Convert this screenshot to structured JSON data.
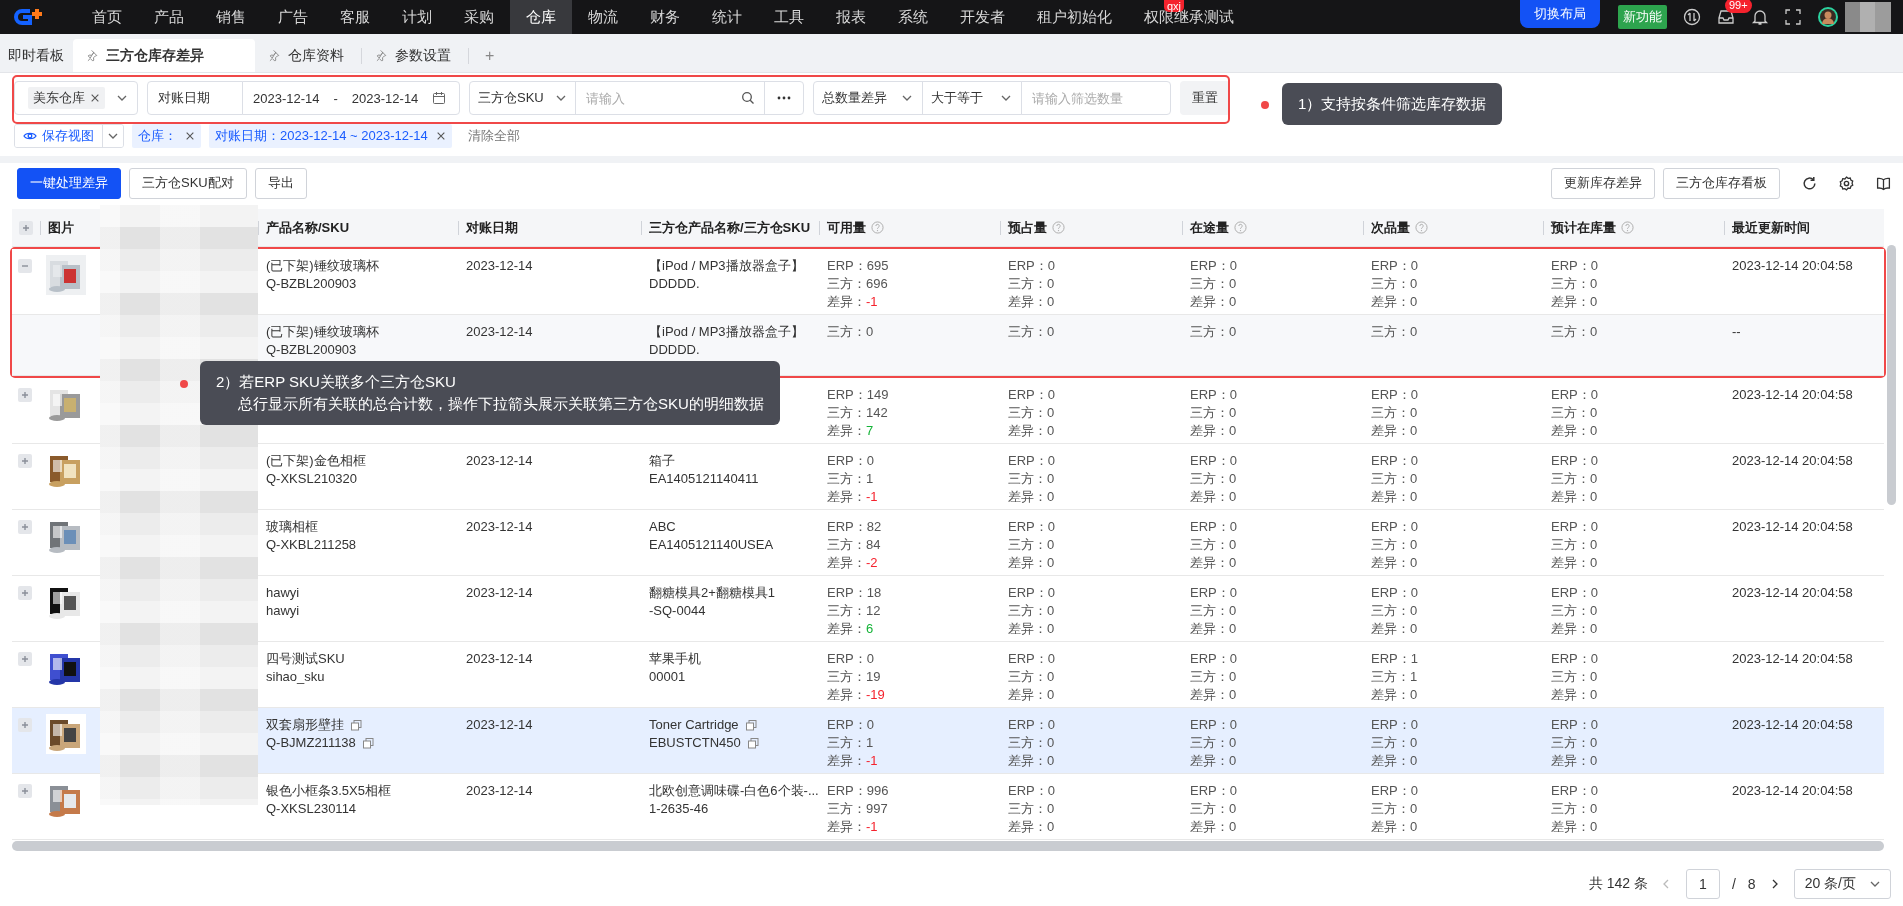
{
  "top_nav": {
    "items": [
      {
        "label": "首页",
        "selected": false
      },
      {
        "label": "产品",
        "selected": false
      },
      {
        "label": "销售",
        "selected": false
      },
      {
        "label": "广告",
        "selected": false
      },
      {
        "label": "客服",
        "selected": false
      },
      {
        "label": "计划",
        "selected": false
      },
      {
        "label": "采购",
        "selected": false
      },
      {
        "label": "仓库",
        "selected": true
      },
      {
        "label": "物流",
        "selected": false
      },
      {
        "label": "财务",
        "selected": false
      },
      {
        "label": "统计",
        "selected": false
      },
      {
        "label": "工具",
        "selected": false
      },
      {
        "label": "报表",
        "selected": false
      },
      {
        "label": "系统",
        "selected": false
      },
      {
        "label": "开发者",
        "selected": false
      },
      {
        "label": "租户初始化",
        "selected": false
      },
      {
        "label": "权限继承测试",
        "selected": false,
        "tag": "qxj"
      }
    ],
    "layout_button": "切换布局",
    "new_badge": "新功能",
    "inbox_count": "99+"
  },
  "tab_bar": {
    "tabs": [
      {
        "label": "即时看板",
        "selected": false,
        "pinned": false
      },
      {
        "label": "三方仓库存差异",
        "selected": true,
        "pinned": true
      },
      {
        "label": "仓库资料",
        "selected": false,
        "pinned": true
      },
      {
        "label": "参数设置",
        "selected": false,
        "pinned": true
      }
    ],
    "add": "+"
  },
  "filters": {
    "warehouse_tag": "美东仓库",
    "date_label": "对账日期",
    "date_start": "2023-12-14",
    "date_separator": "-",
    "date_end": "2023-12-14",
    "sku_type": "三方仓SKU",
    "search_placeholder": "请输入",
    "diff_type": "总数量差异",
    "comparator": "大于等于",
    "quantity_placeholder": "请输入筛选数量",
    "reset": "重置"
  },
  "chips": {
    "save_view": "保存视图",
    "tags": [
      "仓库：",
      "对账日期：2023-12-14 ~ 2023-12-14"
    ],
    "clear": "清除全部"
  },
  "actions": {
    "left": [
      {
        "label": "一键处理差异",
        "kind": "primary"
      },
      {
        "label": "三方仓SKU配对",
        "kind": "default"
      },
      {
        "label": "导出",
        "kind": "default"
      }
    ],
    "right": [
      {
        "label": "更新库存差异",
        "kind": "default"
      },
      {
        "label": "三方仓库存看板",
        "kind": "default"
      }
    ]
  },
  "table": {
    "columns": [
      {
        "label": "图片",
        "help": false
      },
      {
        "label": "产品名称/SKU",
        "help": false
      },
      {
        "label": "对账日期",
        "help": false
      },
      {
        "label": "三方仓产品名称/三方仓SKU",
        "help": false
      },
      {
        "label": "可用量",
        "help": true
      },
      {
        "label": "预占量",
        "help": true
      },
      {
        "label": "在途量",
        "help": true
      },
      {
        "label": "次品量",
        "help": true
      },
      {
        "label": "预计在库量",
        "help": true
      },
      {
        "label": "最近更新时间",
        "help": false
      }
    ],
    "rows": [
      {
        "kind": "main",
        "expanded": true,
        "selected": false,
        "image": {
          "kind": "picture"
        },
        "product_name": "(已下架)锤纹玻璃杯",
        "sku": "Q-BZBL200903",
        "copyable": false,
        "date": "2023-12-14",
        "tp_name": "【iPod / MP3播放器盒子】",
        "tp_sku": "DDDDD.",
        "metrics": [
          [
            {
              "label": "ERP：",
              "value": "695"
            },
            {
              "label": "三方：",
              "value": "696"
            },
            {
              "label": "差异：",
              "value": "-1",
              "color": "#f5222d"
            }
          ],
          [
            {
              "label": "ERP：",
              "value": "0"
            },
            {
              "label": "三方：",
              "value": "0"
            },
            {
              "label": "差异：",
              "value": "0"
            }
          ],
          [
            {
              "label": "ERP：",
              "value": "0"
            },
            {
              "label": "三方：",
              "value": "0"
            },
            {
              "label": "差异：",
              "value": "0"
            }
          ],
          [
            {
              "label": "ERP：",
              "value": "0"
            },
            {
              "label": "三方：",
              "value": "0"
            },
            {
              "label": "差异：",
              "value": "0"
            }
          ],
          [
            {
              "label": "ERP：",
              "value": "0"
            },
            {
              "label": "三方：",
              "value": "0"
            },
            {
              "label": "差异：",
              "value": "0"
            }
          ]
        ],
        "updated": "2023-12-14 20:04:58"
      },
      {
        "kind": "detail",
        "selected": false,
        "product_name": "(已下架)锤纹玻璃杯",
        "sku": "Q-BZBL200903",
        "copyable": false,
        "date": "2023-12-14",
        "tp_name": "【iPod / MP3播放器盒子】",
        "tp_sku": "DDDDD.",
        "metrics": [
          [
            {
              "label": "三方：",
              "value": "0"
            }
          ],
          [
            {
              "label": "三方：",
              "value": "0"
            }
          ],
          [
            {
              "label": "三方：",
              "value": "0"
            }
          ],
          [
            {
              "label": "三方：",
              "value": "0"
            }
          ],
          [
            {
              "label": "三方：",
              "value": "0"
            }
          ]
        ],
        "updated": "--"
      },
      {
        "kind": "main",
        "expanded": false,
        "selected": false,
        "image": {
          "kind": "picture"
        },
        "metrics": [
          [
            {
              "label": "ERP：",
              "value": "149"
            },
            {
              "label": "三方：",
              "value": "142"
            },
            {
              "label": "差异：",
              "value": "7",
              "color": "#14b337"
            }
          ],
          [
            {
              "label": "ERP：",
              "value": "0"
            },
            {
              "label": "三方：",
              "value": "0"
            },
            {
              "label": "差异：",
              "value": "0"
            }
          ],
          [
            {
              "label": "ERP：",
              "value": "0"
            },
            {
              "label": "三方：",
              "value": "0"
            },
            {
              "label": "差异：",
              "value": "0"
            }
          ],
          [
            {
              "label": "ERP：",
              "value": "0"
            },
            {
              "label": "三方：",
              "value": "0"
            },
            {
              "label": "差异：",
              "value": "0"
            }
          ],
          [
            {
              "label": "ERP：",
              "value": "0"
            },
            {
              "label": "三方：",
              "value": "0"
            },
            {
              "label": "差异：",
              "value": "0"
            }
          ]
        ],
        "updated": "2023-12-14 20:04:58"
      },
      {
        "kind": "main",
        "expanded": false,
        "selected": false,
        "image": {
          "kind": "picture"
        },
        "product_name": "(已下架)金色相框",
        "sku": "Q-XKSL210320",
        "copyable": false,
        "date": "2023-12-14",
        "tp_name": "箱子",
        "tp_sku": "EA1405121140411",
        "metrics": [
          [
            {
              "label": "ERP：",
              "value": "0"
            },
            {
              "label": "三方：",
              "value": "1"
            },
            {
              "label": "差异：",
              "value": "-1",
              "color": "#f5222d"
            }
          ],
          [
            {
              "label": "ERP：",
              "value": "0"
            },
            {
              "label": "三方：",
              "value": "0"
            },
            {
              "label": "差异：",
              "value": "0"
            }
          ],
          [
            {
              "label": "ERP：",
              "value": "0"
            },
            {
              "label": "三方：",
              "value": "0"
            },
            {
              "label": "差异：",
              "value": "0"
            }
          ],
          [
            {
              "label": "ERP：",
              "value": "0"
            },
            {
              "label": "三方：",
              "value": "0"
            },
            {
              "label": "差异：",
              "value": "0"
            }
          ],
          [
            {
              "label": "ERP：",
              "value": "0"
            },
            {
              "label": "三方：",
              "value": "0"
            },
            {
              "label": "差异：",
              "value": "0"
            }
          ]
        ],
        "updated": "2023-12-14 20:04:58"
      },
      {
        "kind": "main",
        "expanded": false,
        "selected": false,
        "image": {
          "kind": "picture"
        },
        "product_name": "玻璃相框",
        "sku": "Q-XKBL211258",
        "copyable": false,
        "date": "2023-12-14",
        "tp_name": "ABC",
        "tp_sku": "EA1405121140USEA",
        "metrics": [
          [
            {
              "label": "ERP：",
              "value": "82"
            },
            {
              "label": "三方：",
              "value": "84"
            },
            {
              "label": "差异：",
              "value": "-2",
              "color": "#f5222d"
            }
          ],
          [
            {
              "label": "ERP：",
              "value": "0"
            },
            {
              "label": "三方：",
              "value": "0"
            },
            {
              "label": "差异：",
              "value": "0"
            }
          ],
          [
            {
              "label": "ERP：",
              "value": "0"
            },
            {
              "label": "三方：",
              "value": "0"
            },
            {
              "label": "差异：",
              "value": "0"
            }
          ],
          [
            {
              "label": "ERP：",
              "value": "0"
            },
            {
              "label": "三方：",
              "value": "0"
            },
            {
              "label": "差异：",
              "value": "0"
            }
          ],
          [
            {
              "label": "ERP：",
              "value": "0"
            },
            {
              "label": "三方：",
              "value": "0"
            },
            {
              "label": "差异：",
              "value": "0"
            }
          ]
        ],
        "updated": "2023-12-14 20:04:58"
      },
      {
        "kind": "main",
        "expanded": false,
        "selected": false,
        "image": {
          "kind": "picture"
        },
        "product_name": "hawyi",
        "sku": "hawyi",
        "copyable": false,
        "date": "2023-12-14",
        "tp_name": "翻糖模具2+翻糖模具1",
        "tp_sku": "-SQ-0044",
        "metrics": [
          [
            {
              "label": "ERP：",
              "value": "18"
            },
            {
              "label": "三方：",
              "value": "12"
            },
            {
              "label": "差异：",
              "value": "6",
              "color": "#14b337"
            }
          ],
          [
            {
              "label": "ERP：",
              "value": "0"
            },
            {
              "label": "三方：",
              "value": "0"
            },
            {
              "label": "差异：",
              "value": "0"
            }
          ],
          [
            {
              "label": "ERP：",
              "value": "0"
            },
            {
              "label": "三方：",
              "value": "0"
            },
            {
              "label": "差异：",
              "value": "0"
            }
          ],
          [
            {
              "label": "ERP：",
              "value": "0"
            },
            {
              "label": "三方：",
              "value": "0"
            },
            {
              "label": "差异：",
              "value": "0"
            }
          ],
          [
            {
              "label": "ERP：",
              "value": "0"
            },
            {
              "label": "三方：",
              "value": "0"
            },
            {
              "label": "差异：",
              "value": "0"
            }
          ]
        ],
        "updated": "2023-12-14 20:04:58"
      },
      {
        "kind": "main",
        "expanded": false,
        "selected": false,
        "image": {
          "kind": "picture"
        },
        "product_name": "四号测试SKU",
        "sku": "sihao_sku",
        "copyable": false,
        "date": "2023-12-14",
        "tp_name": "苹果手机",
        "tp_sku": "00001",
        "metrics": [
          [
            {
              "label": "ERP：",
              "value": "0"
            },
            {
              "label": "三方：",
              "value": "19"
            },
            {
              "label": "差异：",
              "value": "-19",
              "color": "#f5222d"
            }
          ],
          [
            {
              "label": "ERP：",
              "value": "0"
            },
            {
              "label": "三方：",
              "value": "0"
            },
            {
              "label": "差异：",
              "value": "0"
            }
          ],
          [
            {
              "label": "ERP：",
              "value": "0"
            },
            {
              "label": "三方：",
              "value": "0"
            },
            {
              "label": "差异：",
              "value": "0"
            }
          ],
          [
            {
              "label": "ERP：",
              "value": "1"
            },
            {
              "label": "三方：",
              "value": "1"
            },
            {
              "label": "差异：",
              "value": "0"
            }
          ],
          [
            {
              "label": "ERP：",
              "value": "0"
            },
            {
              "label": "三方：",
              "value": "0"
            },
            {
              "label": "差异：",
              "value": "0"
            }
          ]
        ],
        "updated": "2023-12-14 20:04:58"
      },
      {
        "kind": "main",
        "expanded": false,
        "selected": true,
        "image": {
          "kind": "picture"
        },
        "product_name": "双套扇形壁挂",
        "sku": "Q-BJMZ211138",
        "copyable": true,
        "date": "2023-12-14",
        "tp_name": "Toner Cartridge",
        "tp_sku": "EBUSTCTN450",
        "metrics": [
          [
            {
              "label": "ERP：",
              "value": "0"
            },
            {
              "label": "三方：",
              "value": "1"
            },
            {
              "label": "差异：",
              "value": "-1",
              "color": "#f5222d"
            }
          ],
          [
            {
              "label": "ERP：",
              "value": "0"
            },
            {
              "label": "三方：",
              "value": "0"
            },
            {
              "label": "差异：",
              "value": "0"
            }
          ],
          [
            {
              "label": "ERP：",
              "value": "0"
            },
            {
              "label": "三方：",
              "value": "0"
            },
            {
              "label": "差异：",
              "value": "0"
            }
          ],
          [
            {
              "label": "ERP：",
              "value": "0"
            },
            {
              "label": "三方：",
              "value": "0"
            },
            {
              "label": "差异：",
              "value": "0"
            }
          ],
          [
            {
              "label": "ERP：",
              "value": "0"
            },
            {
              "label": "三方：",
              "value": "0"
            },
            {
              "label": "差异：",
              "value": "0"
            }
          ]
        ],
        "updated": "2023-12-14 20:04:58"
      },
      {
        "kind": "main",
        "expanded": false,
        "selected": false,
        "image": {
          "kind": "picture"
        },
        "product_name": "银色小框条3.5X5相框",
        "sku": "Q-XKSL230114",
        "copyable": false,
        "date": "2023-12-14",
        "tp_name": "北欧创意调味碟-白色6个装-...",
        "tp_sku": "1-2635-46",
        "metrics": [
          [
            {
              "label": "ERP：",
              "value": "996"
            },
            {
              "label": "三方：",
              "value": "997"
            },
            {
              "label": "差异：",
              "value": "-1",
              "color": "#f5222d"
            }
          ],
          [
            {
              "label": "ERP：",
              "value": "0"
            },
            {
              "label": "三方：",
              "value": "0"
            },
            {
              "label": "差异：",
              "value": "0"
            }
          ],
          [
            {
              "label": "ERP：",
              "value": "0"
            },
            {
              "label": "三方：",
              "value": "0"
            },
            {
              "label": "差异：",
              "value": "0"
            }
          ],
          [
            {
              "label": "ERP：",
              "value": "0"
            },
            {
              "label": "三方：",
              "value": "0"
            },
            {
              "label": "差异：",
              "value": "0"
            }
          ],
          [
            {
              "label": "ERP：",
              "value": "0"
            },
            {
              "label": "三方：",
              "value": "0"
            },
            {
              "label": "差异：",
              "value": "0"
            }
          ]
        ],
        "updated": "2023-12-14 20:04:58"
      }
    ]
  },
  "pagination": {
    "total": "共 142 条",
    "page": "1",
    "separator": "/",
    "pages": "8",
    "page_size": "20 条/页"
  },
  "annotations": [
    {
      "lines": [
        "1）支持按条件筛选库存数据"
      ]
    },
    {
      "lines": [
        "2）若ERP SKU关联多个三方仓SKU",
        "总行显示所有关联的总合计数，操作下拉箭头展示关联第三方仓SKU的明细数据"
      ]
    }
  ]
}
